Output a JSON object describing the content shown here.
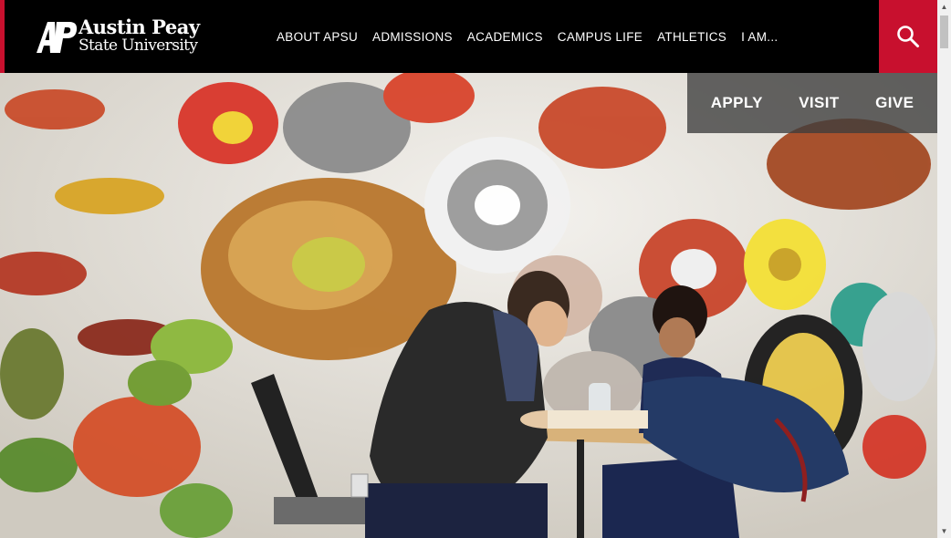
{
  "header": {
    "logo_line1": "Austin Peay",
    "logo_line2": "State University",
    "logo_mark": "AP",
    "nav": [
      {
        "label": "ABOUT APSU"
      },
      {
        "label": "ADMISSIONS"
      },
      {
        "label": "ACADEMICS"
      },
      {
        "label": "CAMPUS LIFE"
      },
      {
        "label": "ATHLETICS"
      },
      {
        "label": "I AM..."
      }
    ],
    "search_icon": "search-icon"
  },
  "quicklinks": [
    {
      "label": "APPLY"
    },
    {
      "label": "VISIT"
    },
    {
      "label": "GIVE"
    }
  ],
  "hero": {
    "image": "students-at-table-with-colorful-butterfly-mural"
  },
  "colors": {
    "brand_red": "#c8102e",
    "header_bg": "#000000"
  }
}
